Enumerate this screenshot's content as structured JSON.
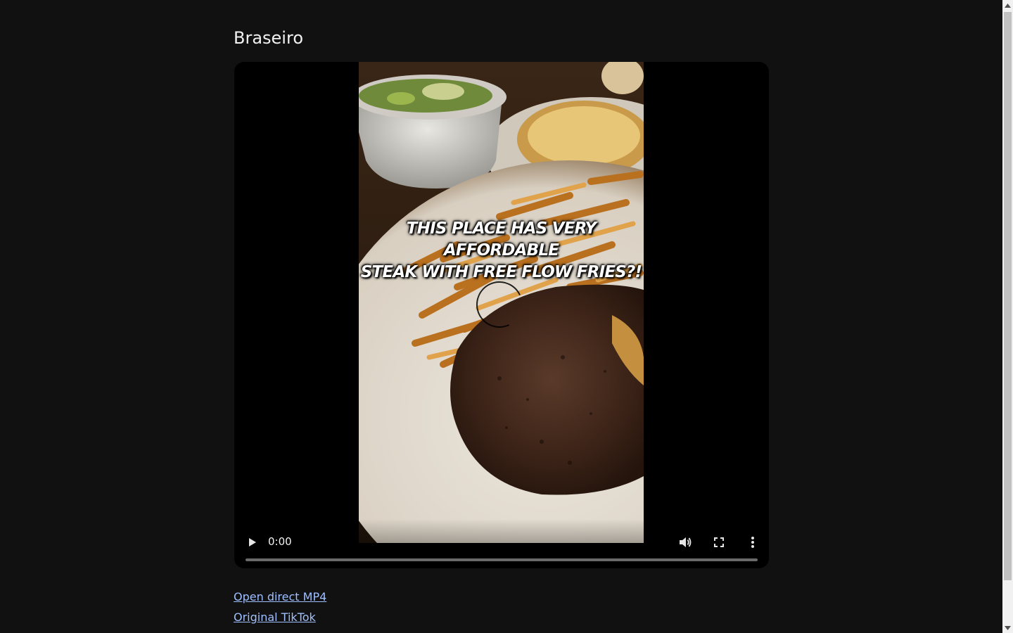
{
  "page": {
    "title": "Braseiro"
  },
  "video": {
    "caption_lines": [
      "This place has very affordable",
      "steak with free flow fries?!"
    ],
    "current_time": "0:00",
    "progress_fraction": 0
  },
  "links": {
    "direct_mp4": "Open direct MP4",
    "original_tiktok": "Original TikTok"
  },
  "icons": {
    "play": "play-icon",
    "volume": "volume-icon",
    "fullscreen": "fullscreen-icon",
    "more": "more-options-icon",
    "loading": "loading-spinner-icon"
  },
  "colors": {
    "background": "#111111",
    "link": "#9fbfff",
    "player_background": "#000000"
  }
}
